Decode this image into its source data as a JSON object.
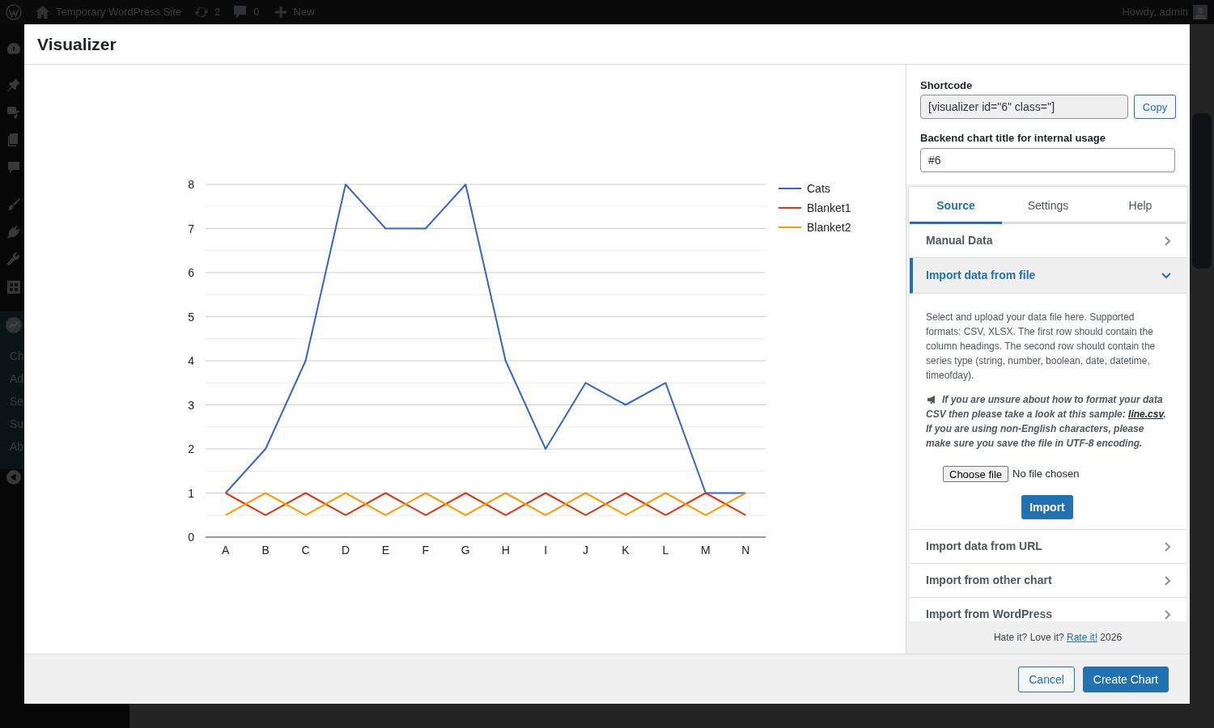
{
  "admin_bar": {
    "site_name": "Temporary WordPress Site",
    "updates_count": "2",
    "comments_count": "0",
    "new_label": "New",
    "greeting": "Howdy, admin"
  },
  "admin_menu": {
    "items": [
      {
        "selected": false
      },
      {
        "selected": false
      },
      {
        "selected": false
      },
      {
        "selected": false
      },
      {
        "selected": false
      },
      {
        "selected": false
      },
      {
        "selected": false
      },
      {
        "selected": false
      },
      {
        "selected": false
      },
      {
        "selected": true,
        "submenu": [
          "Ch",
          "Ad",
          "Se",
          "Su",
          "Ab"
        ]
      }
    ]
  },
  "modal": {
    "title": "Visualizer",
    "chart_data": {
      "type": "line",
      "categories": [
        "A",
        "B",
        "C",
        "D",
        "E",
        "F",
        "G",
        "H",
        "I",
        "J",
        "K",
        "L",
        "M",
        "N"
      ],
      "series": [
        {
          "name": "Cats",
          "color": "#3366cc",
          "values": [
            1,
            2,
            4,
            8,
            7,
            7,
            8,
            4,
            2,
            3.5,
            3,
            3.5,
            1,
            1
          ]
        },
        {
          "name": "Blanket1",
          "color": "#dc3912",
          "values": [
            1,
            0.5,
            1,
            0.5,
            1,
            0.5,
            1,
            0.5,
            1,
            0.5,
            1,
            0.5,
            1,
            0.5
          ]
        },
        {
          "name": "Blanket2",
          "color": "#ff9900",
          "values": [
            0.5,
            1,
            0.5,
            1,
            0.5,
            1,
            0.5,
            1,
            0.5,
            1,
            0.5,
            1,
            0.5,
            1
          ]
        }
      ],
      "ylim": [
        0,
        8
      ],
      "yticks": [
        0,
        1,
        2,
        3,
        4,
        5,
        6,
        7,
        8
      ],
      "grid": true,
      "legend": "right"
    },
    "sidebar": {
      "shortcode": {
        "label": "Shortcode",
        "value": "[visualizer id=\"6\" class='']",
        "button": "Copy"
      },
      "chart_title": {
        "label": "Backend chart title for internal usage",
        "value": "#6"
      },
      "tabs": [
        {
          "label": "Source",
          "selected": true
        },
        {
          "label": "Settings",
          "selected": false
        },
        {
          "label": "Help",
          "selected": false
        }
      ],
      "sections": [
        {
          "title": "Manual Data",
          "expanded": false
        },
        {
          "title": "Import data from file",
          "expanded": true,
          "description": "Select and upload your data file here. Supported formats: CSV, XLSX. The first row should contain the column headings. The second row should contain the series type (string, number, boolean, date, datetime, timeofday).",
          "note": {
            "before_link": "If you are unsure about how to format your data CSV then please take a look at this sample:",
            "link": "line.csv",
            "after_link": ".",
            "second_line": "If you are using non-English characters, please make sure you save the file in UTF-8 encoding."
          },
          "file_button": "Choose file",
          "file_status": "No file chosen",
          "import_button": "Import"
        },
        {
          "title": "Import data from URL",
          "expanded": false
        },
        {
          "title": "Import from other chart",
          "expanded": false
        },
        {
          "title": "Import from WordPress",
          "expanded": false
        }
      ],
      "rating": {
        "before_link": "Hate it? Love it?",
        "link": "Rate it!",
        "after_link": "2026"
      }
    },
    "footer": {
      "buttons": [
        {
          "label": "Cancel",
          "kind": "secondary"
        },
        {
          "label": "Create Chart",
          "kind": "primary"
        }
      ]
    }
  }
}
